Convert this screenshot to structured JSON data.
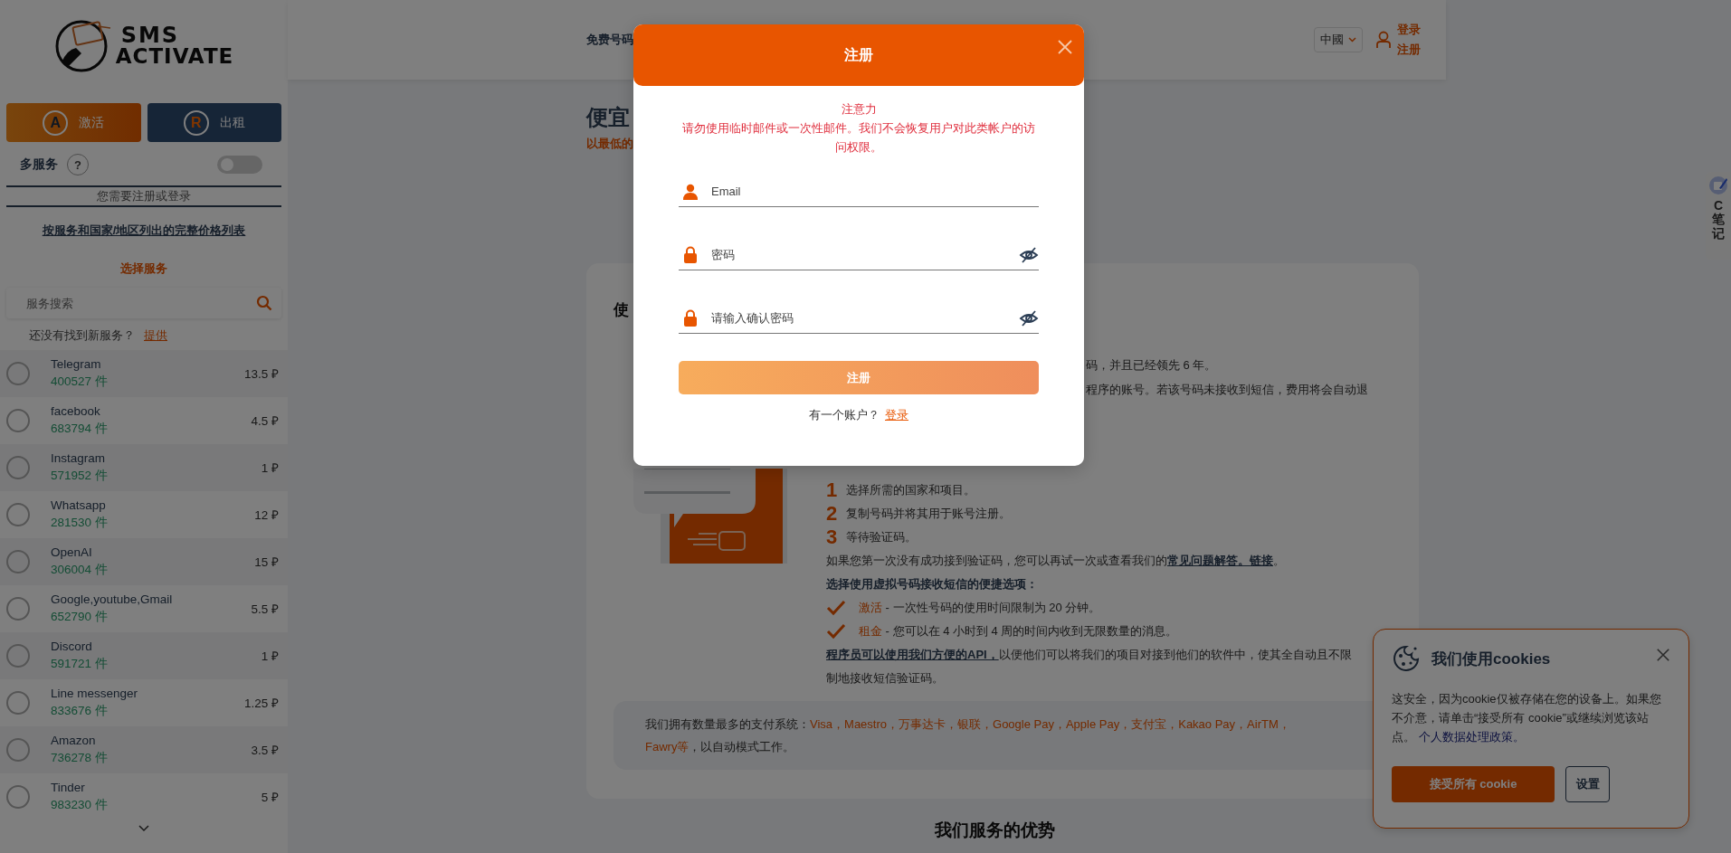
{
  "sidebar": {
    "logo": {
      "line_1": "SMS",
      "line_2": "ACTIVATE"
    },
    "mode_buttons": [
      {
        "kind": "activate",
        "icon_letter": "A",
        "label": "激活"
      },
      {
        "kind": "rent",
        "icon_letter": "R",
        "label": "出租"
      }
    ],
    "multi_service": {
      "label": "多服务",
      "help": "?",
      "on": false
    },
    "auth_notice": "您需要注册或登录",
    "price_list_link": "按服务和国家/地区列出的完整价格列表",
    "section_title": "选择服务",
    "search": {
      "placeholder": "服务搜索"
    },
    "suggest": {
      "text": "还没有找到新服务？",
      "link": "提供"
    },
    "services": [
      {
        "name": "Telegram",
        "count": "400527 件",
        "price": "13.5 ₽",
        "selected": false
      },
      {
        "name": "facebook",
        "count": "683794 件",
        "price": "4.5 ₽",
        "selected": false
      },
      {
        "name": "Instagram",
        "count": "571952 件",
        "price": "1 ₽",
        "selected": false
      },
      {
        "name": "Whatsapp",
        "count": "281530 件",
        "price": "12 ₽",
        "selected": false
      },
      {
        "name": "OpenAI",
        "count": "306004 件",
        "price": "15 ₽",
        "selected": false
      },
      {
        "name": "Google,youtube,Gmail",
        "count": "652790 件",
        "price": "5.5 ₽",
        "selected": false
      },
      {
        "name": "Discord",
        "count": "591721 件",
        "price": "1 ₽",
        "selected": false
      },
      {
        "name": "Line messenger",
        "count": "833676 件",
        "price": "1.25 ₽",
        "selected": false
      },
      {
        "name": "Amazon",
        "count": "736278 件",
        "price": "3.5 ₽",
        "selected": false
      },
      {
        "name": "Tinder",
        "count": "983230 件",
        "price": "5 ₽",
        "selected": false
      }
    ]
  },
  "header": {
    "nav_item": "免费号码",
    "language": "中國",
    "login": "登录",
    "register": "注册"
  },
  "main": {
    "title": "便宜",
    "subtitle": "以最低的",
    "card": {
      "heading": "使",
      "intro_lines": [
        "码，并且已经领先 6 年。",
        "程序的账号。若该号码未接收到短信，费用将会自动退"
      ],
      "steps": [
        {
          "number": "1",
          "text": "选择所需的国家和项目。"
        },
        {
          "number": "2",
          "text": "复制号码并将其用于账号注册。"
        },
        {
          "number": "3",
          "text": "等待验证码。"
        }
      ],
      "faq": {
        "before": "如果您第一次没有成功接到验证码，您可以再试一次或查看我们的",
        "link": "常见问题解答。链接",
        "after": "。"
      },
      "options_title": "选择使用虚拟号码接收短信的便捷选项：",
      "options": [
        {
          "label": "激活",
          "text": " - 一次性号码的使用时间限制为 20 分钟。"
        },
        {
          "label": "租金",
          "text": " - 您可以在 4 小时到 4 周的时间内收到无限数量的消息。"
        }
      ],
      "api": {
        "link": "程序员可以使用我们方便的API，",
        "text": "以便他们可以将我们的项目对接到他们的软件中，使其全自动且不限制地接收短信验证码。"
      },
      "payments": {
        "prefix": "我们拥有数量最多的支付系统：",
        "systems": "Visa，Maestro，万事达卡，银联，Google Pay，Apple Pay，支付宝，Kakao Pay，AirTM，Fawry等",
        "suffix": "，以自动模式工作。"
      }
    },
    "next_section_title": "我们服务的优势"
  },
  "modal": {
    "title": "注册",
    "notice_title": "注意力",
    "notice_text": "请勿使用临时邮件或一次性邮件。我们不会恢复用户对此类帐户的访问权限。",
    "fields": [
      {
        "kind": "email",
        "placeholder": "Email"
      },
      {
        "kind": "password",
        "placeholder": "密码"
      },
      {
        "kind": "password",
        "placeholder": "请输入确认密码"
      }
    ],
    "submit": "注册",
    "footer_text": "有一个账户？",
    "footer_link": "登录"
  },
  "cookie": {
    "title": "我们使用cookies",
    "text": "这安全，因为cookie仅被存储在您的设备上。如果您不介意，请单击“接受所有 cookie”或继续浏览该站点。",
    "link": "个人数据处理政策。",
    "accept": "接受所有 cookie",
    "settings": "设置"
  },
  "side_widget": {
    "label": "C笔记"
  }
}
